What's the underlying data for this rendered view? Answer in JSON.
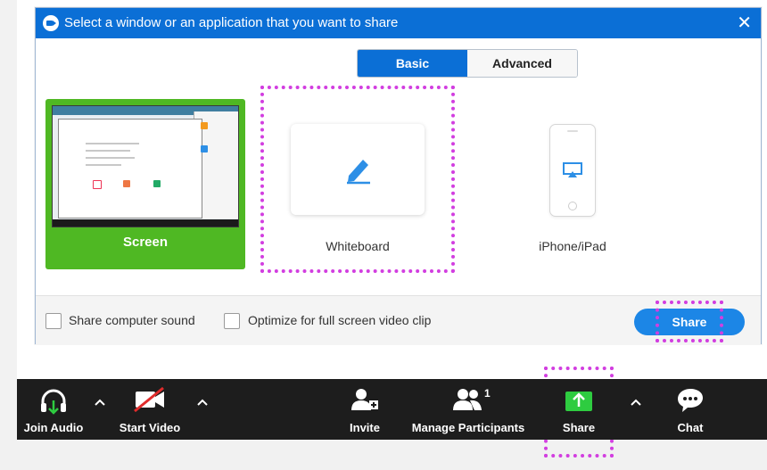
{
  "dialog": {
    "title": "Select a window or an application that you want to share",
    "close_glyph": "✕",
    "tabs": [
      {
        "label": "Basic",
        "active": true
      },
      {
        "label": "Advanced",
        "active": false
      }
    ],
    "options": [
      {
        "label": "Screen",
        "icon": "monitor-screenshot"
      },
      {
        "label": "Whiteboard",
        "icon": "pen-icon"
      },
      {
        "label": "iPhone/iPad",
        "icon": "airplay-icon"
      }
    ],
    "checkboxes": [
      {
        "label": "Share computer sound",
        "checked": false
      },
      {
        "label": "Optimize for full screen video clip",
        "checked": false
      }
    ],
    "share_button": "Share",
    "accent_color": "#0b6fd6",
    "screen_tile_color": "#4fb823",
    "highlight_color": "#d23ee0"
  },
  "toolbar": {
    "join_audio": "Join Audio",
    "start_video": "Start Video",
    "invite": "Invite",
    "manage_participants": "Manage Participants",
    "participants_count": "1",
    "share": "Share",
    "chat": "Chat",
    "share_icon_color": "#2ecc40"
  }
}
